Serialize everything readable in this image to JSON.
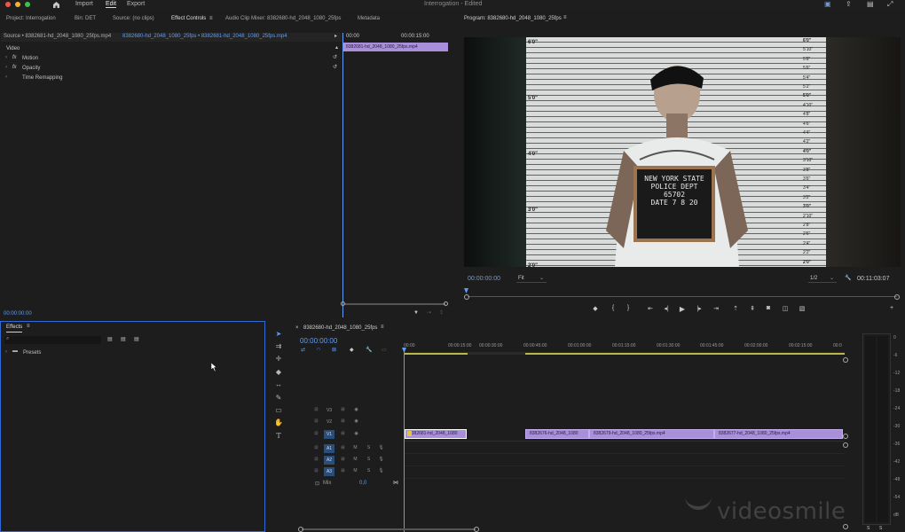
{
  "titlebar": {
    "menu": [
      "Import",
      "Edit",
      "Export"
    ],
    "title": "Interrogation - Edited"
  },
  "top_tabs": [
    "Project: Interrogation",
    "Bin: DET",
    "Source: (no clips)",
    "Effect Controls",
    "Audio Clip Mixer: 8382680-hd_2048_1080_25fps",
    "Metadata"
  ],
  "effect_controls": {
    "source_label": "Source • 8382681-hd_2048_1080_25fps.mp4",
    "sequence_label": "8382680-hd_2048_1080_25fps • 8382681-hd_2048_1080_25fps.mp4",
    "ruler_start": "00:00",
    "ruler_mid": "00:00:15:00",
    "clip_name": "8382681-hd_2048_1080_25fps.mp4",
    "section": "Video",
    "effects": [
      "Motion",
      "Opacity",
      "Time Remapping"
    ],
    "timecode": "00:00:00:00"
  },
  "program": {
    "title": "Program: 8382680-hd_2048_1080_25fps",
    "timecode": "00:00:00:00",
    "fit": "Fit",
    "resolution": "1/2",
    "duration": "00:11:03:07",
    "sign_text": [
      "NEW YORK STATE",
      "POLICE DEPT",
      "65702",
      "DATE 7 8 20"
    ],
    "height_marks_left": [
      "6'0\"",
      "5'0\"",
      "4'0\"",
      "3'0\"",
      "2'0\""
    ],
    "height_marks_right": [
      "6'0\"",
      "5'10\"",
      "5'8\"",
      "5'6\"",
      "5'4\"",
      "5'2\"",
      "5'0\"",
      "4'10\"",
      "4'8\"",
      "4'6\"",
      "4'4\"",
      "4'2\"",
      "4'0\"",
      "3'10\"",
      "3'8\"",
      "3'6\"",
      "3'4\"",
      "3'2\"",
      "3'0\"",
      "2'10\"",
      "2'8\"",
      "2'6\"",
      "2'4\"",
      "2'2\"",
      "2'0\""
    ]
  },
  "effects_panel": {
    "title": "Effects",
    "presets": "Presets"
  },
  "timeline": {
    "sequence_tab": "8382680-hd_2048_1080_25fps",
    "timecode": "00:00:00:00",
    "ruler": [
      "00:00",
      "00:00:15:00",
      "00:00:30:00",
      "00:00:45:00",
      "00:01:00:00",
      "00:01:15:00",
      "00:01:30:00",
      "00:01:45:00",
      "00:02:00:00",
      "00:02:15:00",
      "00:0"
    ],
    "video_tracks": [
      "V3",
      "V2",
      "V1"
    ],
    "audio_tracks": [
      "A1",
      "A2",
      "A3"
    ],
    "mix_label": "Mix",
    "mix_value": "0,0",
    "clips": [
      "8382681-hd_2048_1080",
      "8382676-hd_2048_1080",
      "8382679-hd_2048_1080_25fps.mp4",
      "8382677-hd_2048_1080_25fps.mp4"
    ]
  },
  "audio_meter": {
    "labels": [
      "0",
      "-6",
      "-12",
      "-18",
      "-24",
      "-30",
      "-36",
      "-42",
      "-48",
      "-54",
      "dB"
    ],
    "solo": [
      "S",
      "S"
    ]
  },
  "watermark": "videosmile",
  "colors": {
    "accent_blue": "#2f6ad6",
    "clip_purple": "#a98fda",
    "playhead": "#5e9cf5"
  }
}
